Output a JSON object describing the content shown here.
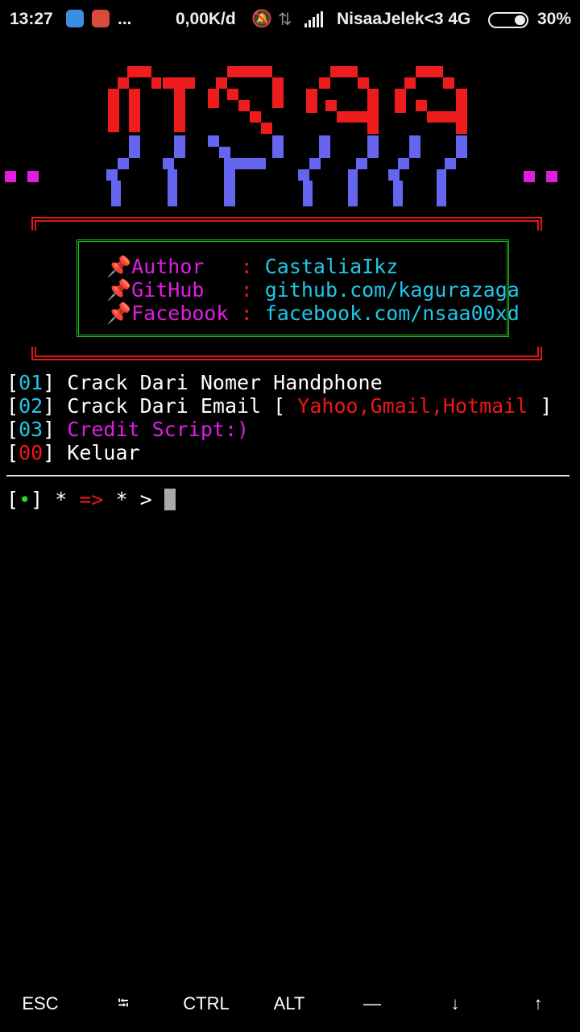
{
  "status_bar": {
    "time": "13:27",
    "dots": "...",
    "speed": "0,00K/d",
    "carrier": "NisaaJelek<3 4G",
    "battery": "30%"
  },
  "banner": {
    "logo_text": "NSAA",
    "info": [
      {
        "label": "📌Author",
        "sep": ":",
        "value": "CastaliaIkz"
      },
      {
        "label": "📌GitHub",
        "sep": ":",
        "value": "github.com/kagurazaga"
      },
      {
        "label": "📌Facebook",
        "sep": ":",
        "value": "facebook.com/nsaa00xd"
      }
    ]
  },
  "menu": [
    {
      "num": "01",
      "text": "Crack Dari Nomer Handphone"
    },
    {
      "num": "02",
      "text": "Crack Dari Email",
      "open": "[",
      "extra": "Yahoo,Gmail,Hotmail",
      "close": "]"
    },
    {
      "num": "03",
      "text": "Credit Script:)"
    },
    {
      "num": "00",
      "text": "Keluar"
    }
  ],
  "prompt": {
    "bullet": "•",
    "star1": "*",
    "arrow": "=>",
    "star2": "*",
    "gt": ">"
  },
  "extra_keys": [
    "ESC",
    "⭾",
    "CTRL",
    "ALT",
    "—",
    "↓",
    "↑"
  ],
  "colors": {
    "cyan": "#1fc8e8",
    "magenta": "#e01ee0",
    "red": "#f01717",
    "green": "#22dd22",
    "blue": "#5f5ff0"
  }
}
